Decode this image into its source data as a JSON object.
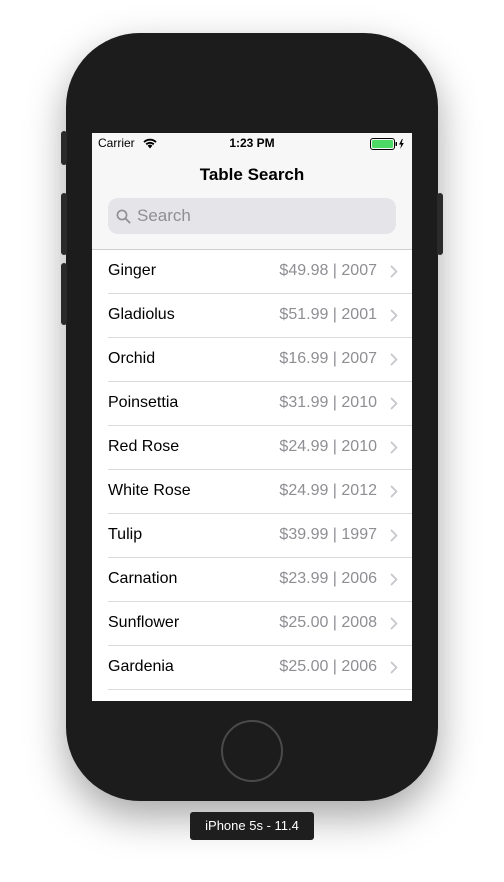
{
  "status_bar": {
    "carrier": "Carrier",
    "time": "1:23 PM",
    "battery_color": "#4cd964"
  },
  "nav": {
    "title": "Table Search"
  },
  "search": {
    "placeholder": "Search",
    "value": ""
  },
  "rows": [
    {
      "title": "Ginger",
      "detail": "$49.98 | 2007"
    },
    {
      "title": "Gladiolus",
      "detail": "$51.99 | 2001"
    },
    {
      "title": "Orchid",
      "detail": "$16.99 | 2007"
    },
    {
      "title": "Poinsettia",
      "detail": "$31.99 | 2010"
    },
    {
      "title": "Red Rose",
      "detail": "$24.99 | 2010"
    },
    {
      "title": "White Rose",
      "detail": "$24.99 | 2012"
    },
    {
      "title": "Tulip",
      "detail": "$39.99 | 1997"
    },
    {
      "title": "Carnation",
      "detail": "$23.99 | 2006"
    },
    {
      "title": "Sunflower",
      "detail": "$25.00 | 2008"
    },
    {
      "title": "Gardenia",
      "detail": "$25.00 | 2006"
    }
  ],
  "simulator": {
    "device_label": "iPhone 5s - 11.4"
  },
  "icons": {
    "wifi": "wifi-icon",
    "battery": "battery-icon",
    "search": "search-icon",
    "chevron": "chevron-right-icon"
  }
}
